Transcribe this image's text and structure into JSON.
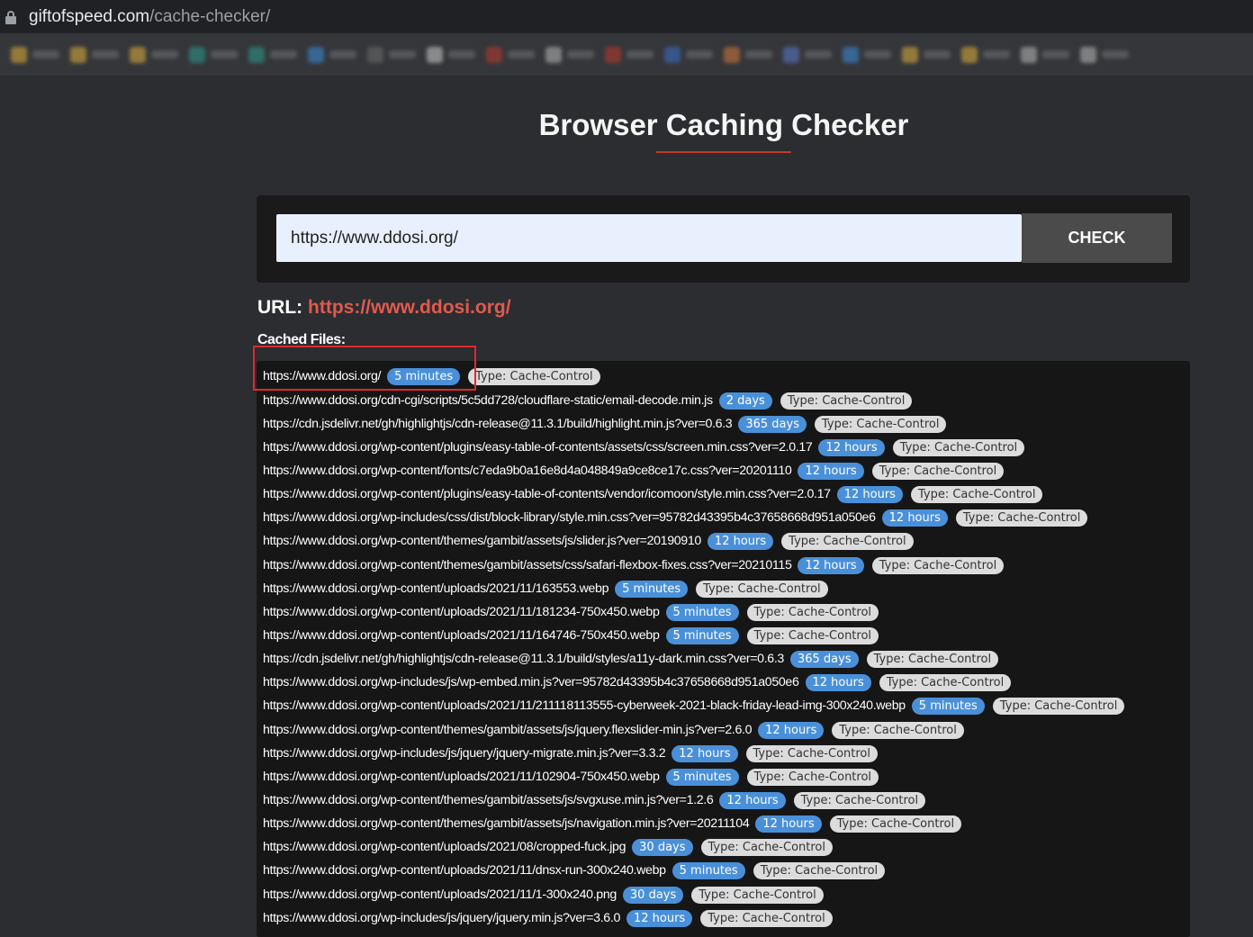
{
  "browser": {
    "url_host": "giftofspeed.com",
    "url_path": "/cache-checker/"
  },
  "bookmarks": [
    {
      "fav": "#e2b23a"
    },
    {
      "fav": "#e2b23a"
    },
    {
      "fav": "#e2b23a"
    },
    {
      "fav": "#2a9d8f"
    },
    {
      "fav": "#2a9d8f"
    },
    {
      "fav": "#3b8ee0"
    },
    {
      "fav": "#6d6d6d"
    },
    {
      "fav": "#d0d0d0"
    },
    {
      "fav": "#c0392b"
    },
    {
      "fav": "#bbbbbb"
    },
    {
      "fav": "#c0392b"
    },
    {
      "fav": "#3b6fd0"
    },
    {
      "fav": "#d77a3a"
    },
    {
      "fav": "#5b7bd0"
    },
    {
      "fav": "#3b8ee0"
    },
    {
      "fav": "#e2b23a"
    },
    {
      "fav": "#e2b23a"
    },
    {
      "fav": "#bbbbbb"
    },
    {
      "fav": "#bbbbbb"
    }
  ],
  "page": {
    "title": "Browser Caching Checker",
    "input_value": "https://www.ddosi.org/",
    "check_label": "CHECK",
    "url_label": "URL:",
    "url_value": "https://www.ddosi.org/",
    "cached_label": "Cached Files:"
  },
  "files": [
    {
      "url": "https://www.ddosi.org/",
      "time": "5 minutes",
      "type": "Type: Cache-Control"
    },
    {
      "url": "https://www.ddosi.org/cdn-cgi/scripts/5c5dd728/cloudflare-static/email-decode.min.js",
      "time": "2 days",
      "type": "Type: Cache-Control"
    },
    {
      "url": "https://cdn.jsdelivr.net/gh/highlightjs/cdn-release@11.3.1/build/highlight.min.js?ver=0.6.3",
      "time": "365 days",
      "type": "Type: Cache-Control"
    },
    {
      "url": "https://www.ddosi.org/wp-content/plugins/easy-table-of-contents/assets/css/screen.min.css?ver=2.0.17",
      "time": "12 hours",
      "type": "Type: Cache-Control"
    },
    {
      "url": "https://www.ddosi.org/wp-content/fonts/c7eda9b0a16e8d4a048849a9ce8ce17c.css?ver=20201110",
      "time": "12 hours",
      "type": "Type: Cache-Control"
    },
    {
      "url": "https://www.ddosi.org/wp-content/plugins/easy-table-of-contents/vendor/icomoon/style.min.css?ver=2.0.17",
      "time": "12 hours",
      "type": "Type: Cache-Control"
    },
    {
      "url": "https://www.ddosi.org/wp-includes/css/dist/block-library/style.min.css?ver=95782d43395b4c37658668d951a050e6",
      "time": "12 hours",
      "type": "Type: Cache-Control"
    },
    {
      "url": "https://www.ddosi.org/wp-content/themes/gambit/assets/js/slider.js?ver=20190910",
      "time": "12 hours",
      "type": "Type: Cache-Control"
    },
    {
      "url": "https://www.ddosi.org/wp-content/themes/gambit/assets/css/safari-flexbox-fixes.css?ver=20210115",
      "time": "12 hours",
      "type": "Type: Cache-Control"
    },
    {
      "url": "https://www.ddosi.org/wp-content/uploads/2021/11/163553.webp",
      "time": "5 minutes",
      "type": "Type: Cache-Control"
    },
    {
      "url": "https://www.ddosi.org/wp-content/uploads/2021/11/181234-750x450.webp",
      "time": "5 minutes",
      "type": "Type: Cache-Control"
    },
    {
      "url": "https://www.ddosi.org/wp-content/uploads/2021/11/164746-750x450.webp",
      "time": "5 minutes",
      "type": "Type: Cache-Control"
    },
    {
      "url": "https://cdn.jsdelivr.net/gh/highlightjs/cdn-release@11.3.1/build/styles/a11y-dark.min.css?ver=0.6.3",
      "time": "365 days",
      "type": "Type: Cache-Control"
    },
    {
      "url": "https://www.ddosi.org/wp-includes/js/wp-embed.min.js?ver=95782d43395b4c37658668d951a050e6",
      "time": "12 hours",
      "type": "Type: Cache-Control"
    },
    {
      "url": "https://www.ddosi.org/wp-content/uploads/2021/11/211118113555-cyberweek-2021-black-friday-lead-img-300x240.webp",
      "time": "5 minutes",
      "type": "Type: Cache-Control"
    },
    {
      "url": "https://www.ddosi.org/wp-content/themes/gambit/assets/js/jquery.flexslider-min.js?ver=2.6.0",
      "time": "12 hours",
      "type": "Type: Cache-Control"
    },
    {
      "url": "https://www.ddosi.org/wp-includes/js/jquery/jquery-migrate.min.js?ver=3.3.2",
      "time": "12 hours",
      "type": "Type: Cache-Control"
    },
    {
      "url": "https://www.ddosi.org/wp-content/uploads/2021/11/102904-750x450.webp",
      "time": "5 minutes",
      "type": "Type: Cache-Control"
    },
    {
      "url": "https://www.ddosi.org/wp-content/themes/gambit/assets/js/svgxuse.min.js?ver=1.2.6",
      "time": "12 hours",
      "type": "Type: Cache-Control"
    },
    {
      "url": "https://www.ddosi.org/wp-content/themes/gambit/assets/js/navigation.min.js?ver=20211104",
      "time": "12 hours",
      "type": "Type: Cache-Control"
    },
    {
      "url": "https://www.ddosi.org/wp-content/uploads/2021/08/cropped-fuck.jpg",
      "time": "30 days",
      "type": "Type: Cache-Control"
    },
    {
      "url": "https://www.ddosi.org/wp-content/uploads/2021/11/dnsx-run-300x240.webp",
      "time": "5 minutes",
      "type": "Type: Cache-Control"
    },
    {
      "url": "https://www.ddosi.org/wp-content/uploads/2021/11/1-300x240.png",
      "time": "30 days",
      "type": "Type: Cache-Control"
    },
    {
      "url": "https://www.ddosi.org/wp-includes/js/jquery/jquery.min.js?ver=3.6.0",
      "time": "12 hours",
      "type": "Type: Cache-Control"
    }
  ]
}
